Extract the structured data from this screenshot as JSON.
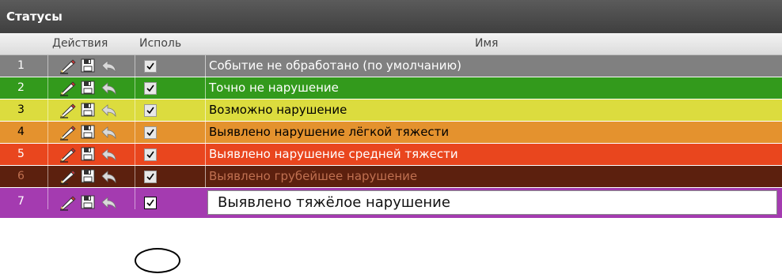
{
  "panel": {
    "title": "Статусы"
  },
  "header": {
    "actions": "Действия",
    "use": "Исполь",
    "name": "Имя"
  },
  "rows": [
    {
      "num": "1",
      "name": "Событие не обработано (по умолчанию)",
      "bg": "#808080",
      "color": "#ffffff",
      "checked": true
    },
    {
      "num": "2",
      "name": "Точно не нарушение",
      "bg": "#339a1c",
      "color": "#ffffff",
      "checked": true
    },
    {
      "num": "3",
      "name": "Возможно нарушение",
      "bg": "#dcdc3e",
      "color": "#000000",
      "checked": true
    },
    {
      "num": "4",
      "name": "Выявлено нарушение лёгкой тяжести",
      "bg": "#e4922e",
      "color": "#000000",
      "checked": true
    },
    {
      "num": "5",
      "name": "Выявлено нарушение средней тяжести",
      "bg": "#e9461e",
      "color": "#ffffff",
      "checked": true
    },
    {
      "num": "6",
      "name": "Выявлено грубейшее нарушение",
      "bg": "#5c200e",
      "color": "#c07050",
      "checked": true
    },
    {
      "num": "7",
      "name": "Выявлено тяжёлое нарушение",
      "bg": "#a43bb0",
      "color": "#ffffff",
      "checked": true,
      "editing": true
    }
  ],
  "icons": {
    "edit": "pencil-icon",
    "save": "floppy-disk-icon",
    "undo": "undo-icon"
  }
}
